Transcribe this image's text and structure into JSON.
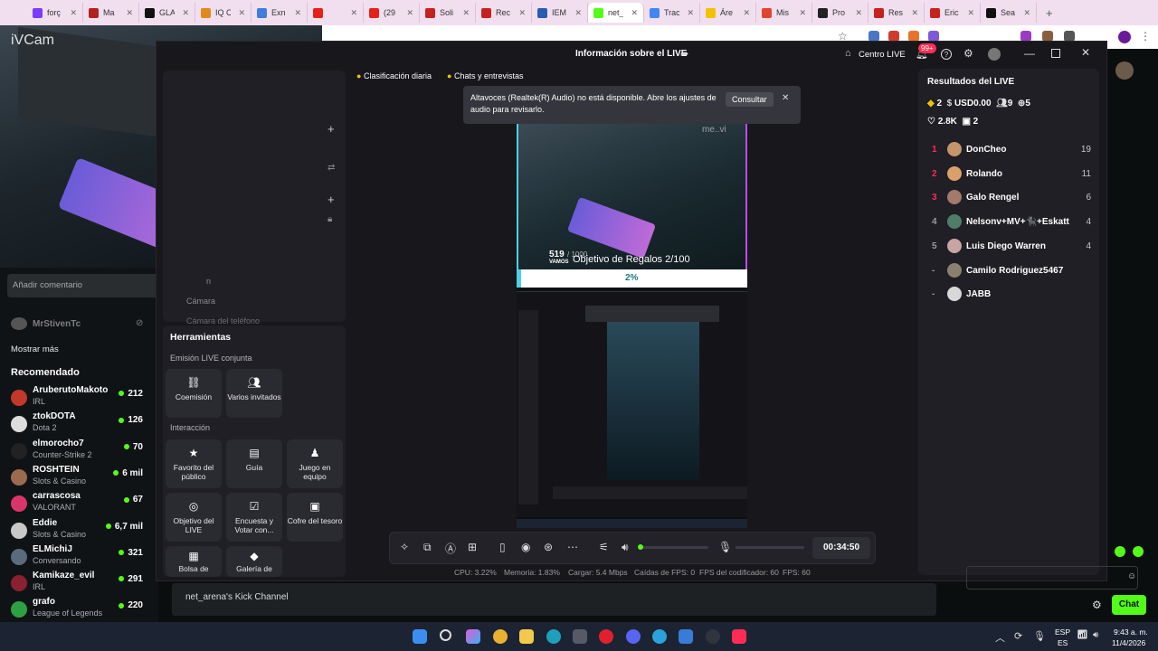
{
  "browser": {
    "tabs": [
      {
        "label": "forç",
        "color": "#7a3cff"
      },
      {
        "label": "Ma",
        "color": "#b32020"
      },
      {
        "label": "GLA",
        "color": "#111111"
      },
      {
        "label": "IQ C",
        "color": "#e08a1e"
      },
      {
        "label": "Exn",
        "color": "#3d7de0"
      },
      {
        "label": "",
        "color": "#e62117"
      },
      {
        "label": "(29",
        "color": "#e62117"
      },
      {
        "label": "Soli",
        "color": "#c5221f"
      },
      {
        "label": "Rec",
        "color": "#c5221f"
      },
      {
        "label": "IEM",
        "color": "#2a5db0"
      },
      {
        "label": "net_",
        "color": "#53fc18"
      },
      {
        "label": "Trac",
        "color": "#4285f4"
      },
      {
        "label": "Áre",
        "color": "#f2c200"
      },
      {
        "label": "Mis",
        "color": "#e2442f"
      },
      {
        "label": "Pro",
        "color": "#222222"
      },
      {
        "label": "Res",
        "color": "#c5221f"
      },
      {
        "label": "Eric",
        "color": "#c5221f"
      },
      {
        "label": "Sea",
        "color": "#111111"
      }
    ]
  },
  "camera_overlay": {
    "watermark": "iVCam",
    "comment_placeholder": "Añadir comentario"
  },
  "sidebar": {
    "followed_user": "MrStivenTc",
    "show_more": "Mostrar más",
    "recommended_title": "Recomendado",
    "recommended": [
      {
        "name": "AruberutoMakoto",
        "category": "IRL",
        "viewers": "212",
        "color": "#c0392b"
      },
      {
        "name": "ztokDOTA",
        "category": "Dota 2",
        "viewers": "126",
        "color": "#dddddd"
      },
      {
        "name": "elmorocho7",
        "category": "Counter-Strike 2",
        "viewers": "70",
        "color": "#222222"
      },
      {
        "name": "ROSHTEIN",
        "category": "Slots & Casino",
        "viewers": "6 mil",
        "color": "#9b6b4f"
      },
      {
        "name": "carrascosa",
        "category": "VALORANT",
        "viewers": "67",
        "color": "#d9356b"
      },
      {
        "name": "Eddie",
        "category": "Slots & Casino",
        "viewers": "6,7 mil",
        "color": "#c8c8c8"
      },
      {
        "name": "ELMichiJ",
        "category": "Conversando",
        "viewers": "321",
        "color": "#5a6b7d"
      },
      {
        "name": "Kamikaze_evil",
        "category": "IRL",
        "viewers": "291",
        "color": "#8a2030"
      },
      {
        "name": "grafo",
        "category": "League of Legends",
        "viewers": "220",
        "color": "#2ea043"
      }
    ]
  },
  "studio": {
    "title": "Información sobre el LIVE",
    "centro_live": "Centro LIVE",
    "notif_badge": "99+",
    "pills": [
      "Clasificación diaria",
      "Chats y entrevistas"
    ],
    "toast": {
      "message": "Altavoces (Realtek(R) Audio) no está disponible. Abre los ajustes de audio para revisarlo.",
      "button": "Consultar"
    },
    "sources": [
      "n",
      "Cámara",
      "Cámara del teléfono"
    ],
    "tools": {
      "title": "Herramientas",
      "section1": "Emisión LIVE conjunta",
      "section2": "Interacción",
      "items1": [
        "Coemisión",
        "Varios invitados"
      ],
      "items2": [
        "Favorito del público",
        "Guía",
        "Juego en equipo",
        "Objetivo del LIVE",
        "Encuesta y Votar con...",
        "Cofre del tesoro",
        "Bolsa de",
        "Galería de"
      ]
    },
    "preview": {
      "count": "519",
      "count_total": "/ 1000",
      "count_sub": "VAMOS",
      "goal_text": "Objetivo de Regalos",
      "goal_value": "2/100",
      "goal_percent": "2%",
      "watermark": "me..vi"
    },
    "timer": "00:34:50",
    "stats": {
      "cpu": "CPU:  3.22%",
      "memory": "Memoria:  1.83%",
      "upload": "Cargar:  5.4 Mbps",
      "fps_drops": "Caídas de FPS:  0",
      "encoder_fps": "FPS del codificador:  60",
      "fps": "FPS:  60"
    },
    "results": {
      "title": "Resultados del LIVE",
      "diamonds": "2",
      "usd": "USD0.00",
      "viewers": "9",
      "new_followers": "5",
      "likes": "2.8K",
      "gifts": "2"
    },
    "leaderboard": [
      {
        "rank": "1",
        "name": "DonCheo",
        "score": "19",
        "color": "#c4956a"
      },
      {
        "rank": "2",
        "name": "Rolando",
        "score": "11",
        "color": "#d9a06b"
      },
      {
        "rank": "3",
        "name": "Galo Rengel",
        "score": "6",
        "color": "#a47a6a"
      },
      {
        "rank": "4",
        "name": "Nelsonᴠ+MV+🐈‍⬛+Eskatt",
        "score": "4",
        "color": "#4f7d6a"
      },
      {
        "rank": "5",
        "name": "Luis Diego Warren",
        "score": "4",
        "color": "#c9a4a4"
      },
      {
        "rank": "-",
        "name": "Camilo Rodriguez5467",
        "score": "",
        "color": "#8a8070"
      },
      {
        "rank": "-",
        "name": "JABB",
        "score": "",
        "color": "#d8d8d8"
      }
    ]
  },
  "chat": {
    "channel_placeholder": "net_arena's Kick Channel",
    "chat_button": "Chat"
  },
  "taskbar": {
    "lang": "ESP",
    "lang_sub": "ES",
    "time": "9:43 a. m.",
    "date": "11/4/2026"
  }
}
